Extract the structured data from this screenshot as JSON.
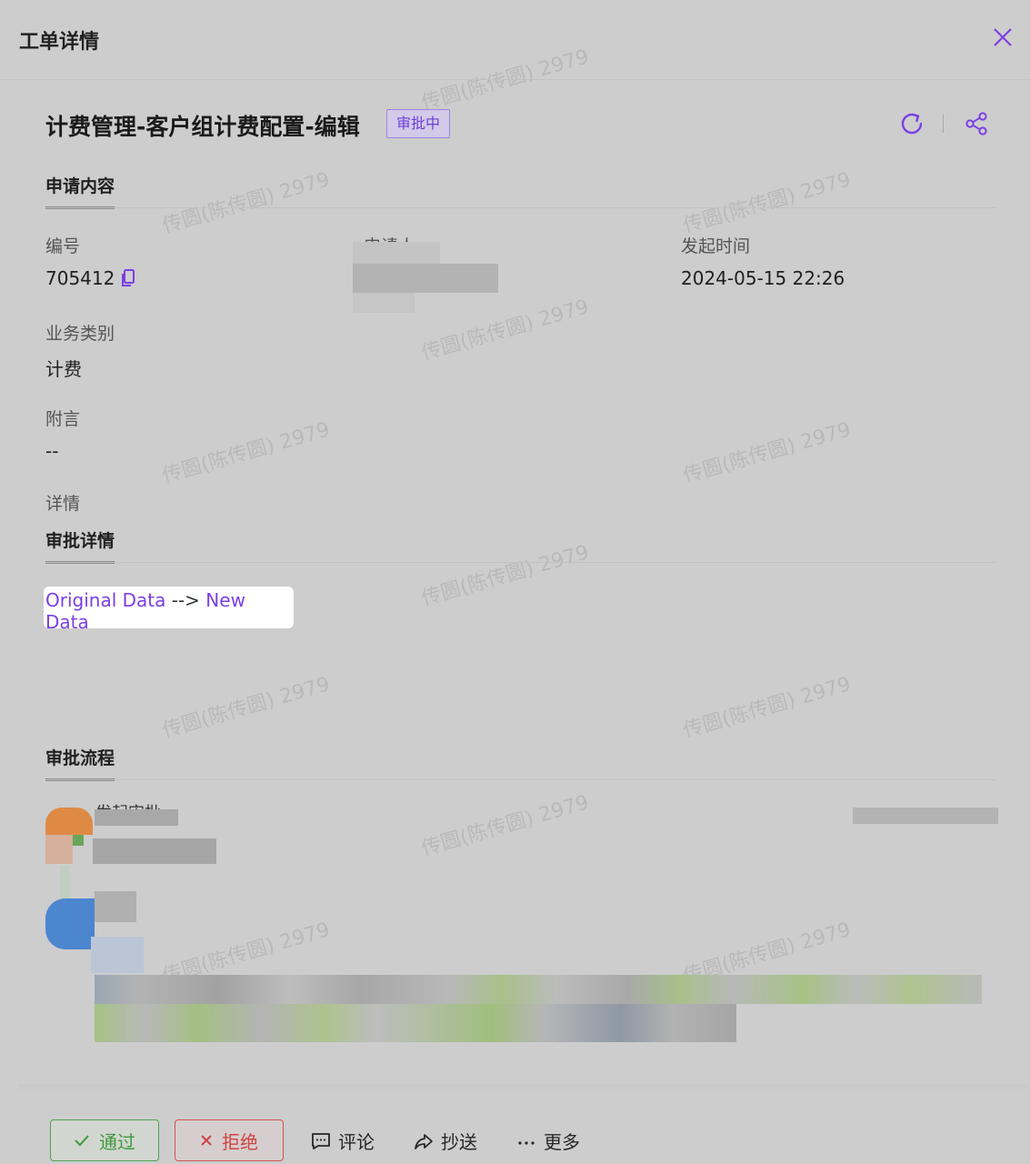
{
  "header": {
    "title": "工单详情"
  },
  "ticket": {
    "title": "计费管理-客户组计费配置-编辑",
    "status": "审批中"
  },
  "tabs": {
    "content": "申请内容",
    "approval_detail": "审批详情",
    "approval_flow": "审批流程"
  },
  "fields": {
    "number_label": "编号",
    "number_value": "705412",
    "applicant_label": "申请人",
    "start_time_label": "发起时间",
    "start_time_value": "2024-05-15 22:26",
    "category_label": "业务类别",
    "category_value": "计费",
    "note_label": "附言",
    "note_value": "--",
    "detail_label": "详情"
  },
  "diff": {
    "original": "Original Data",
    "arrow": "-->",
    "new": "New Data"
  },
  "flow": {
    "step1_title": "发起审批"
  },
  "footer": {
    "approve": "通过",
    "reject": "拒绝",
    "comment": "评论",
    "cc": "抄送",
    "more": "更多"
  },
  "watermark": "传圆(陈传圆) 2979",
  "colors": {
    "accent": "#7b3fe4",
    "approve": "#3e9a3e",
    "reject": "#d04343"
  },
  "icons": [
    "close-icon",
    "refresh-icon",
    "share-icon",
    "copy-icon",
    "check-icon",
    "cross-icon",
    "comment-icon",
    "forward-icon",
    "more-icon"
  ]
}
